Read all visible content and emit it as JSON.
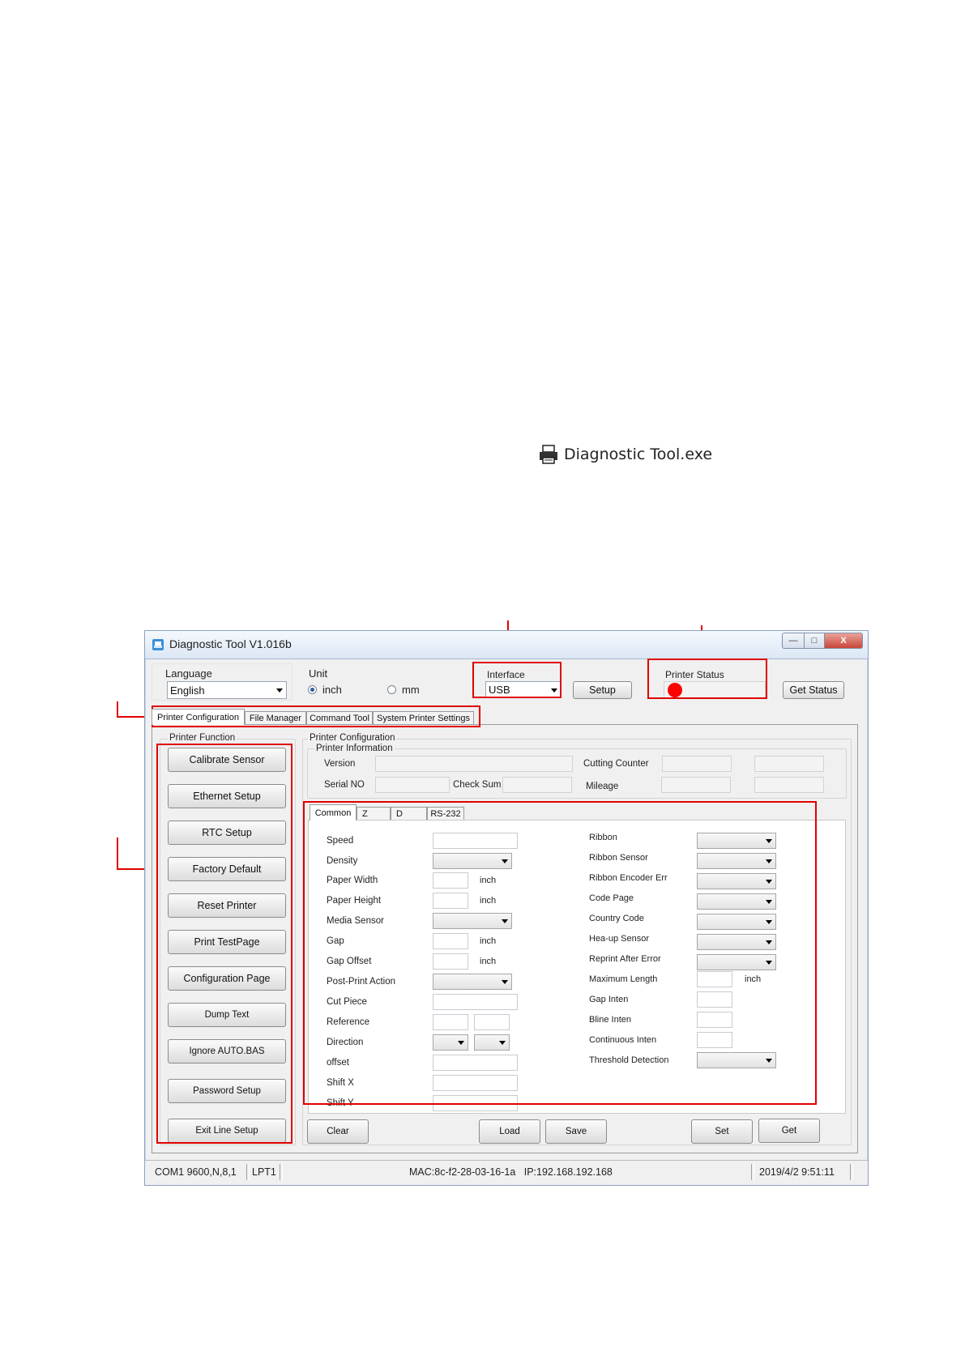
{
  "exe_label": "Diagnostic Tool.exe",
  "window": {
    "title": "Diagnostic Tool V1.016b",
    "close_label": "X"
  },
  "toolbar": {
    "language_label": "Language",
    "language_value": "English",
    "unit_label": "Unit",
    "unit_inch": "inch",
    "unit_mm": "mm",
    "interface_label": "Interface",
    "interface_value": "USB",
    "setup_button": "Setup",
    "printer_status_label": "Printer  Status",
    "get_status_button": "Get Status"
  },
  "main_tabs": [
    "Printer Configuration",
    "File Manager",
    "Command Tool",
    "System Printer Settings"
  ],
  "printer_function": {
    "title": "Printer  Function",
    "buttons": [
      "Calibrate Sensor",
      "Ethernet Setup",
      "RTC Setup",
      "Factory Default",
      "Reset Printer",
      "Print TestPage",
      "Configuration Page",
      "Dump Text",
      "Ignore AUTO.BAS",
      "Password Setup",
      "Exit Line Setup"
    ]
  },
  "printer_configuration": {
    "title": "Printer Configuration",
    "info_title": "Printer Information",
    "version_label": "Version",
    "serial_label": "Serial NO",
    "checksum_label": "Check Sum",
    "cutting_counter_label": "Cutting Counter",
    "mileage_label": "Mileage"
  },
  "sub_tabs": [
    "Common",
    "Z",
    "D",
    "RS-232"
  ],
  "common_left": {
    "speed": "Speed",
    "density": "Density",
    "paper_width": "Paper Width",
    "paper_height": "Paper Height",
    "media_sensor": "Media Sensor",
    "gap": "Gap",
    "gap_offset": "Gap Offset",
    "post_print_action": "Post-Print  Action",
    "cut_piece": "Cut  Piece",
    "reference": "Reference",
    "direction": "Direction",
    "offset": "offset",
    "shift_x": "Shift X",
    "shift_y": "Shift Y",
    "unit_inch": "inch"
  },
  "common_right": {
    "ribbon": "Ribbon",
    "ribbon_sensor": "Ribbon  Sensor",
    "ribbon_encoder_err": "Ribbon Encoder Err",
    "code_page": "Code Page",
    "country_code": "Country Code",
    "head_up_sensor": "Hea-up  Sensor",
    "reprint_after_error": "Reprint After  Error",
    "maximum_length": "Maximum Length",
    "gap_inten": "Gap Inten",
    "bline_inten": "Bline  Inten",
    "continuous_inten": "Continuous  Inten",
    "threshold_detection": "Threshold  Detection",
    "unit_inch": "inch"
  },
  "bottom_buttons": {
    "clear": "Clear",
    "load": "Load",
    "save": "Save",
    "set": "Set",
    "get": "Get"
  },
  "statusbar": {
    "com": "COM1 9600,N,8,1",
    "lpt": "LPT1",
    "network": "MAC:8c-f2-28-03-16-1a   IP:192.168.192.168",
    "datetime": "2019/4/2 9:51:11"
  },
  "colors": {
    "annotation_red": "#e00000",
    "status_dot": "#ff0000"
  }
}
